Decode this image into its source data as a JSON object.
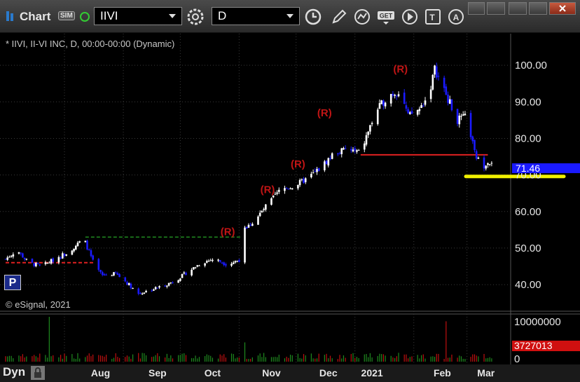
{
  "toolbar": {
    "title": "Chart",
    "sim_badge": "SIM",
    "symbol": "IIVI",
    "interval": "D"
  },
  "chart": {
    "header": "* IIVI, II-VI INC, D, 00:00-00:00 (Dynamic)",
    "copyright": "© eSignal, 2021",
    "last_price_label": "71.46",
    "last_volume_label": "3727013",
    "volume_axis_label": "10000000",
    "volume_zero": "0",
    "p_button": "P",
    "bottom_label": "Dyn"
  },
  "colors": {
    "up": "#ffffff",
    "down": "#1a1aff",
    "background": "#000000",
    "grid": "#3a3a3a",
    "axis_panel": "#000000",
    "resistance": "#e02020",
    "support_green": "#1f8a1f",
    "highlight": "#f0f000",
    "price_tag": "#1a1aff",
    "volume_tag": "#d01010",
    "vol_up": "#1f8a1f",
    "vol_down": "#c01010",
    "r_label": "#c01515",
    "seq": "#1f9a1f"
  },
  "chart_data": {
    "type": "candlestick",
    "symbol": "IIVI",
    "interval": "D",
    "yticks": [
      40,
      50,
      60,
      70,
      80,
      90,
      100
    ],
    "ylim": [
      33.5,
      107.5
    ],
    "x_tick_labels": [
      "Aug",
      "Sep",
      "Oct",
      "Nov",
      "Dec",
      "2021",
      "Feb",
      "Mar"
    ],
    "close_path": [
      [
        "Jul 1",
        47.0
      ],
      [
        "Jul 7",
        49.5
      ],
      [
        "Jul 13",
        46.0
      ],
      [
        "Jul 20",
        45.0
      ],
      [
        "Jul 27",
        47.0
      ],
      [
        "Aug 3",
        49.0
      ],
      [
        "Aug 10",
        52.0
      ],
      [
        "Aug 12",
        51.5
      ],
      [
        "Aug 17",
        45.0
      ],
      [
        "Aug 21",
        42.5
      ],
      [
        "Aug 28",
        43.0
      ],
      [
        "Sep 3",
        40.5
      ],
      [
        "Sep 9",
        37.5
      ],
      [
        "Sep 15",
        38.5
      ],
      [
        "Sep 21",
        39.5
      ],
      [
        "Sep 28",
        41.0
      ],
      [
        "Oct 5",
        43.5
      ],
      [
        "Oct 12",
        46.0
      ],
      [
        "Oct 19",
        47.0
      ],
      [
        "Oct 26",
        45.5
      ],
      [
        "Nov 2",
        47.0
      ],
      [
        "Nov 4",
        55.0
      ],
      [
        "Nov 10",
        58.0
      ],
      [
        "Nov 16",
        62.0
      ],
      [
        "Nov 23",
        66.0
      ],
      [
        "Nov 30",
        67.0
      ],
      [
        "Dec 7",
        69.0
      ],
      [
        "Dec 14",
        72.0
      ],
      [
        "Dec 21",
        76.0
      ],
      [
        "Dec 28",
        77.0
      ],
      [
        "Jan 4",
        76.0
      ],
      [
        "Jan 8",
        82.0
      ],
      [
        "Jan 13",
        88.0
      ],
      [
        "Jan 19",
        92.0
      ],
      [
        "Jan 25",
        93.0
      ],
      [
        "Jan 29",
        86.0
      ],
      [
        "Feb 4",
        88.0
      ],
      [
        "Feb 9",
        92.0
      ],
      [
        "Feb 12",
        99.0
      ],
      [
        "Feb 18",
        92.0
      ],
      [
        "Feb 24",
        85.0
      ],
      [
        "Mar 1",
        86.0
      ],
      [
        "Mar 5",
        76.0
      ],
      [
        "Mar 9",
        72.0
      ],
      [
        "Mar 12",
        74.0
      ],
      [
        "Mar 16",
        71.46
      ]
    ],
    "last_price": 71.46,
    "resistance_levels": [
      {
        "value": 46.0,
        "from": "Jul 1",
        "to": "Aug 17"
      },
      {
        "value": 75.5,
        "from": "Jan 4",
        "to": "Mar 12"
      }
    ],
    "support_levels": [
      {
        "value": 53.0,
        "from": "Aug 12",
        "to": "Nov 2"
      }
    ],
    "highlight_level": 69.6,
    "annotations": [
      {
        "text": "(R)",
        "date": "Oct 26",
        "value": 53.5
      },
      {
        "text": "(R)",
        "date": "Nov 16",
        "value": 65.0
      },
      {
        "text": "(R)",
        "date": "Dec 2",
        "value": 72.0
      },
      {
        "text": "(R)",
        "date": "Dec 16",
        "value": 86.0
      },
      {
        "text": "(R)",
        "date": "Jan 25",
        "value": 98.0
      }
    ],
    "volume": {
      "last": 3727013,
      "axis_max_label": 10000000,
      "spikes": [
        {
          "date": "Jul 24",
          "value": 10000000
        },
        {
          "date": "Nov 4",
          "value": 4300000
        },
        {
          "date": "Feb 18",
          "value": 9000000
        },
        {
          "date": "Mar 16",
          "value": 3727013
        }
      ]
    }
  }
}
